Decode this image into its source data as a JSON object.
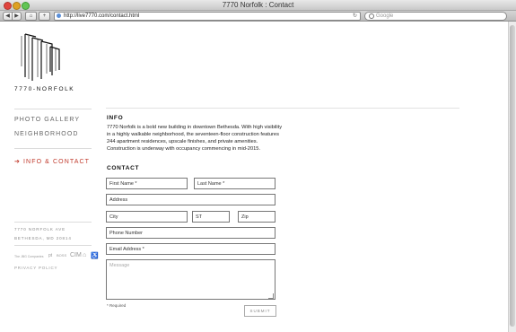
{
  "window": {
    "title": "7770 Norfolk : Contact"
  },
  "toolbar": {
    "back": "◀",
    "forward": "▶",
    "home": "⌂",
    "add": "+",
    "url": "http://live7770.com/contact.html",
    "reload": "↻",
    "search_placeholder": "Google"
  },
  "site": {
    "logo_text": "7770-NORFOLK",
    "nav": [
      {
        "label": "PHOTO GALLERY",
        "active": false
      },
      {
        "label": "NEIGHBORHOOD",
        "active": false
      },
      {
        "label": "➔ INFO & CONTACT",
        "active": true
      }
    ],
    "address": [
      "7770 NORFOLK AVE",
      "BETHESDA, MD 20814"
    ],
    "partners": [
      "The JBG Companies",
      "pt",
      "BOSS",
      "CIM",
      "⌂",
      "♿"
    ],
    "privacy": "PRIVACY POLICY"
  },
  "info": {
    "heading": "INFO",
    "text": "7770 Norfolk is a bold new building in downtown Bethesda. With high visibility in a highly walkable neighborhood, the seventeen-floor construction features 244 apartment residences, upscale finishes, and private amenities. Construction is underway with occupancy commencing in mid-2015."
  },
  "contact": {
    "heading": "CONTACT",
    "fields": {
      "first_name": "First Name *",
      "last_name": "Last Name *",
      "address": "Address",
      "city": "City",
      "state": "ST",
      "zip": "Zip",
      "phone": "Phone Number",
      "email": "Email Address *",
      "message": "Message"
    },
    "required_note": "* Required",
    "submit": "SUBMIT"
  },
  "colors": {
    "accent": "#c0392b",
    "rule": "#dcdcdc"
  }
}
